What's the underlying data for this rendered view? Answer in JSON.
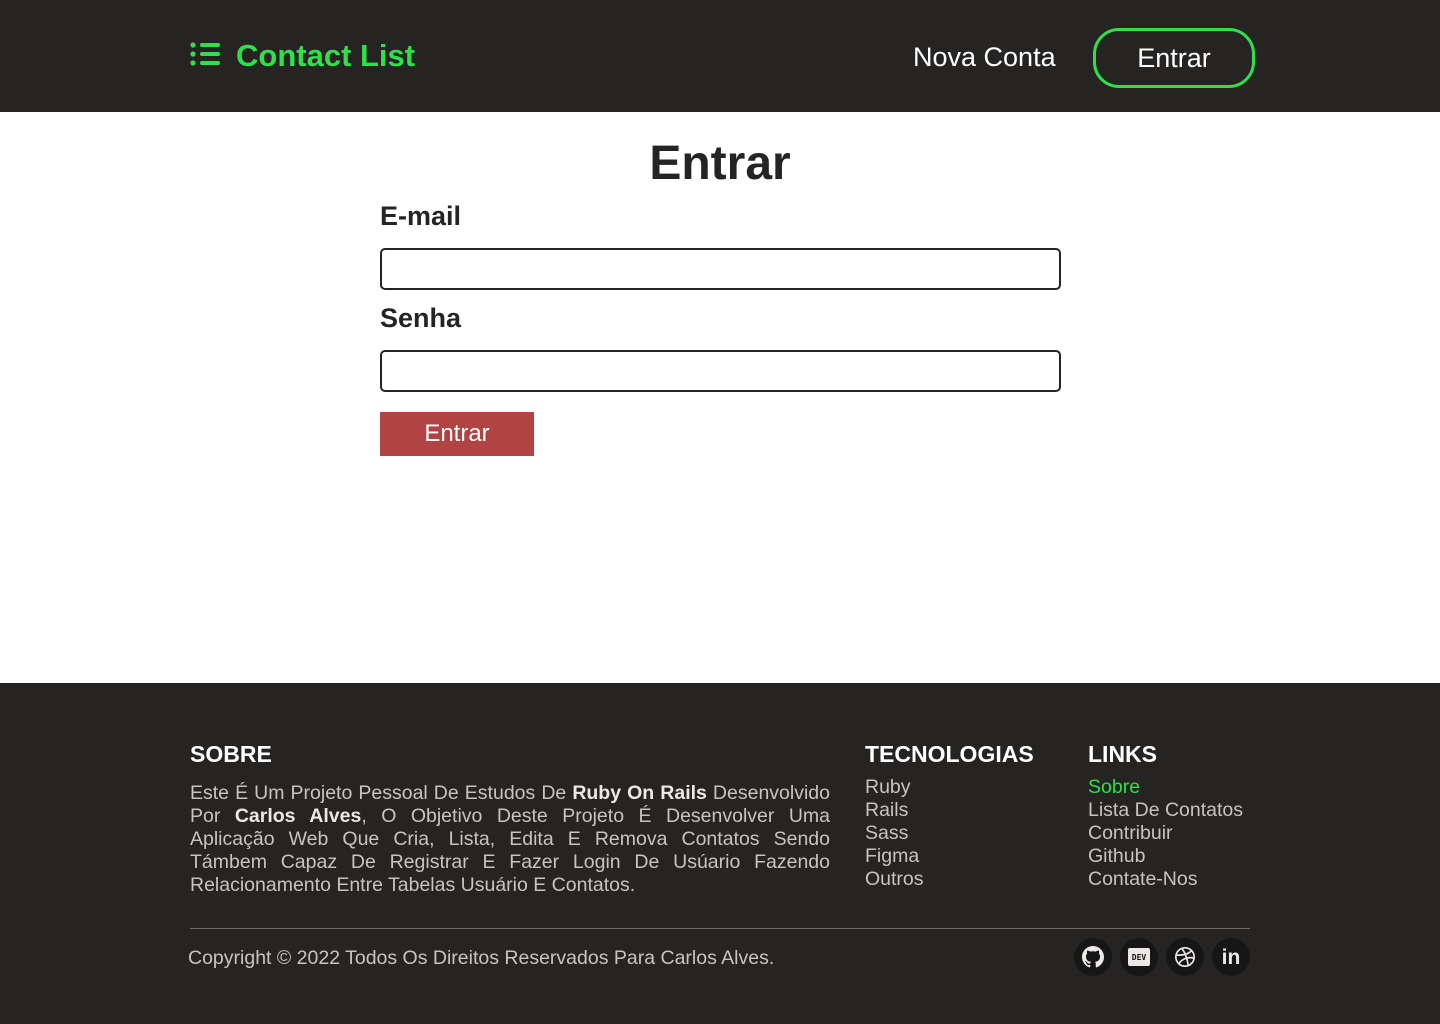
{
  "header": {
    "brand": "Contact List",
    "nav_new_account": "Nova Conta",
    "nav_login": "Entrar"
  },
  "form": {
    "title": "Entrar",
    "email_label": "E-mail",
    "email_value": "",
    "password_label": "Senha",
    "password_value": "",
    "submit_label": "Entrar"
  },
  "footer": {
    "about": {
      "title": "SOBRE",
      "text_1": "Este É Um Projeto Pessoal De Estudos De ",
      "bold_1": "Ruby On Rails",
      "text_2": " Desenvolvido Por ",
      "bold_2": "Carlos Alves",
      "text_3": ", O Objetivo Deste Projeto É Desenvolver Uma Aplicação Web Que Cria, Lista, Edita E Remova Contatos Sendo Támbem Capaz De Registrar E Fazer Login De Usúario Fazendo Relacionamento Entre Tabelas Usuário E Contatos."
    },
    "tech": {
      "title": "TECNOLOGIAS",
      "items": [
        "Ruby",
        "Rails",
        "Sass",
        "Figma",
        "Outros"
      ]
    },
    "links": {
      "title": "LINKS",
      "items": [
        "Sobre",
        "Lista De Contatos",
        "Contribuir",
        "Github",
        "Contate-Nos"
      ]
    },
    "copyright": "Copyright © 2022 Todos Os Direitos Reservados Para Carlos Alves.",
    "social_icons": [
      "github-icon",
      "dev-to-icon",
      "dribbble-icon",
      "linkedin-icon"
    ],
    "dev_badge": "DEV",
    "linkedin_glyph": "in"
  },
  "colors": {
    "dark_bg": "#252423",
    "accent_green": "#2ee04a",
    "button_red": "#b24343",
    "footer_text": "#c8c3bf"
  }
}
